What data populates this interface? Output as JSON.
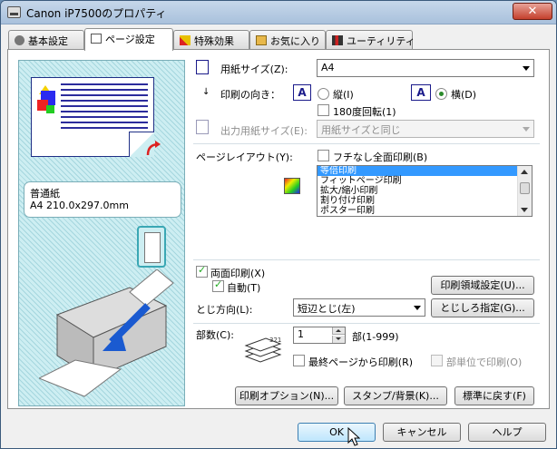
{
  "window": {
    "title": "Canon iP7500のプロパティ",
    "close_glyph": "✕"
  },
  "tabs": [
    {
      "label": "基本設定"
    },
    {
      "label": "ページ設定"
    },
    {
      "label": "特殊効果"
    },
    {
      "label": "お気に入り"
    },
    {
      "label": "ユーティリティ"
    }
  ],
  "preview": {
    "paper_type": "普通紙",
    "paper_size": "A4 210.0x297.0mm"
  },
  "settings": {
    "paper_size_label": "用紙サイズ(Z):",
    "paper_size_value": "A4",
    "orientation_label": "印刷の向き：",
    "portrait_label": "縦(I)",
    "landscape_label": "横(D)",
    "rotate180_label": "180度回転(1)",
    "output_size_label": "出力用紙サイズ(E):",
    "output_size_value": "用紙サイズと同じ",
    "page_layout_label": "ページレイアウト(Y):",
    "borderless_label": "フチなし全面印刷(B)",
    "layout_items": [
      "等倍印刷",
      "フィットページ印刷",
      "拡大/縮小印刷",
      "割り付け印刷",
      "ポスター印刷"
    ],
    "duplex_label": "両面印刷(X)",
    "auto_label": "自動(T)",
    "print_area_button": "印刷領域設定(U)...",
    "binding_label": "とじ方向(L):",
    "binding_value": "短辺とじ(左)",
    "margin_button": "とじしろ指定(G)...",
    "copies_label": "部数(C):",
    "copies_value": "1",
    "copies_range": "部(1-999)",
    "last_page_label": "最終ページから印刷(R)",
    "collate_label": "部単位で印刷(O)",
    "print_options_button": "印刷オプション(N)...",
    "stamp_button": "スタンプ/背景(K)...",
    "defaults_button": "標準に戻す(F)"
  },
  "footer": {
    "ok": "OK",
    "cancel": "キャンセル",
    "help": "ヘルプ"
  }
}
